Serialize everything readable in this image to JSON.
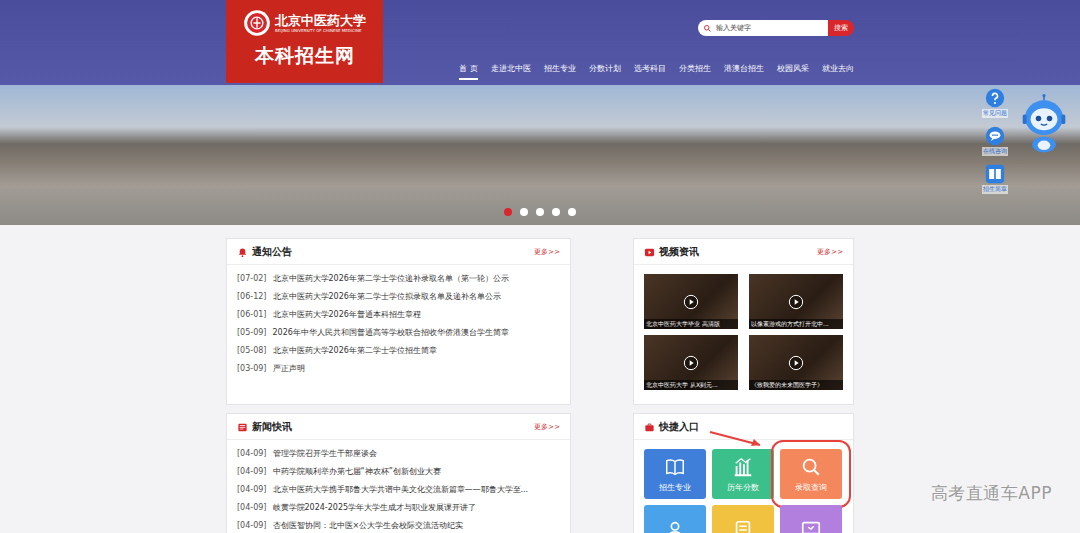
{
  "logo": {
    "name": "北京中医药大学",
    "english": "BEIJING UNIVERSITY OF CHINESE MEDICINE",
    "site": "本科招生网"
  },
  "search": {
    "placeholder": "输入关键字",
    "button": "搜索"
  },
  "nav": [
    {
      "label": "首 页",
      "selected": true
    },
    {
      "label": "走进北中医",
      "selected": false
    },
    {
      "label": "招生专业",
      "selected": false
    },
    {
      "label": "分数计划",
      "selected": false
    },
    {
      "label": "选考科目",
      "selected": false
    },
    {
      "label": "分类招生",
      "selected": false
    },
    {
      "label": "港澳台招生",
      "selected": false
    },
    {
      "label": "校园风采",
      "selected": false
    },
    {
      "label": "就业去向",
      "selected": false
    }
  ],
  "banner": {
    "slides": [
      {
        "selected": true
      },
      {
        "selected": false
      },
      {
        "selected": false
      },
      {
        "selected": false
      },
      {
        "selected": false
      }
    ]
  },
  "float_tools": [
    {
      "label": "常见问题"
    },
    {
      "label": "在线咨询"
    },
    {
      "label": "招生简章"
    }
  ],
  "notices": {
    "title": "通知公告",
    "more": "更多>>",
    "items": [
      {
        "date": "[07-02]",
        "title": "北京中医药大学2026年第二学士学位递补录取名单（第一轮）公示"
      },
      {
        "date": "[06-12]",
        "title": "北京中医药大学2026年第二学士学位拟录取名单及递补名单公示"
      },
      {
        "date": "[06-01]",
        "title": "北京中医药大学2026年普通本科招生章程"
      },
      {
        "date": "[05-09]",
        "title": "2026年中华人民共和国普通高等学校联合招收华侨港澳台学生简章"
      },
      {
        "date": "[05-08]",
        "title": "北京中医药大学2026年第二学士学位招生简章"
      },
      {
        "date": "[03-09]",
        "title": "严正声明"
      }
    ]
  },
  "news": {
    "title": "新闻快讯",
    "more": "更多>>",
    "items": [
      {
        "date": "[04-09]",
        "title": "管理学院召开学生干部座谈会"
      },
      {
        "date": "[04-09]",
        "title": "中药学院顺利举办第七届“神农杯”创新创业大赛"
      },
      {
        "date": "[04-09]",
        "title": "北京中医药大学携手耶鲁大学共谱中美文化交流新篇章——耶鲁大学至..."
      },
      {
        "date": "[04-09]",
        "title": "岐黄学院2024-2025学年大学生成才与职业发展课开讲了"
      },
      {
        "date": "[04-09]",
        "title": "杏创医智协同：北中医×公大学生会校际交流活动纪实"
      }
    ]
  },
  "videos": {
    "title": "视频资讯",
    "more": "更多>>",
    "items": [
      {
        "caption": "北京中医药大学毕业 高清版"
      },
      {
        "caption": "以像素游戏的方式打开北中..."
      },
      {
        "caption": "北京中医药大学 从X到元..."
      },
      {
        "caption": "《致我爱的未来国医学子》"
      }
    ]
  },
  "quick": {
    "title": "快捷入口",
    "items": [
      {
        "label": "招生专业",
        "color": "#3f7fd9",
        "highlighted": false
      },
      {
        "label": "历年分数",
        "color": "#3cc08b",
        "highlighted": false
      },
      {
        "label": "录取查询",
        "color": "#f5875c",
        "highlighted": true
      },
      {
        "color": "#4aa3ea",
        "highlighted": false
      },
      {
        "color": "#f1c23f",
        "highlighted": false
      },
      {
        "color": "#b27fdf",
        "highlighted": false
      }
    ]
  },
  "watermark": "高考直通车APP"
}
